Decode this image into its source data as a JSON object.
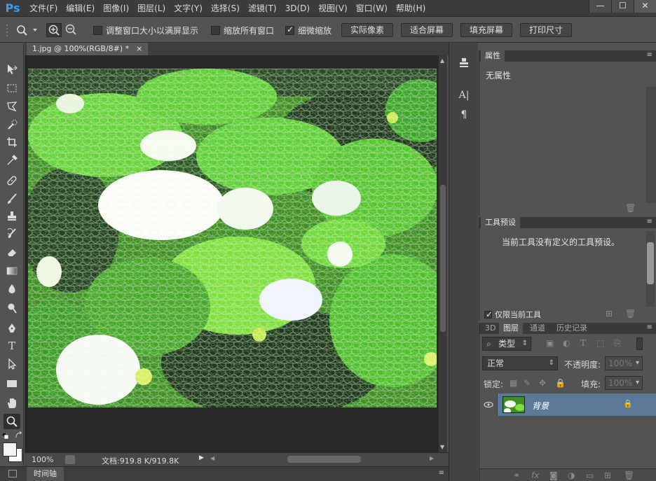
{
  "app": {
    "logo": "Ps"
  },
  "menu": [
    "文件(F)",
    "编辑(E)",
    "图像(I)",
    "图层(L)",
    "文字(Y)",
    "选择(S)",
    "滤镜(T)",
    "3D(D)",
    "视图(V)",
    "窗口(W)",
    "帮助(H)"
  ],
  "window_controls": {
    "minimize": "—",
    "maximize": "☐",
    "close": "✕"
  },
  "options": {
    "resize_windows": {
      "label": "调整窗口大小以满屏显示",
      "checked": false
    },
    "zoom_all": {
      "label": "缩放所有窗口",
      "checked": false
    },
    "scrubby_zoom": {
      "label": "细微缩放",
      "checked": true
    },
    "buttons": [
      "实际像素",
      "适合屏幕",
      "填充屏幕",
      "打印尺寸"
    ]
  },
  "document": {
    "tab_title": "1.jpg @ 100%(RGB/8#) *",
    "tab_close": "×",
    "zoom": "100%",
    "info": "文档:919.8 K/919.8K"
  },
  "timeline": {
    "label": "时间轴"
  },
  "properties": {
    "title": "属性",
    "content": "无属性"
  },
  "tool_presets": {
    "title": "工具预设",
    "message": "当前工具没有定义的工具预设。",
    "current_only": "仅限当前工具",
    "current_only_checked": true
  },
  "layers": {
    "tabs": [
      "3D",
      "图层",
      "通道",
      "历史记录"
    ],
    "active_tab": "图层",
    "filter_label": "类型",
    "blend_mode": "正常",
    "opacity_label": "不透明度:",
    "opacity_value": "100%",
    "lock_label": "锁定:",
    "fill_label": "填充:",
    "fill_value": "100%",
    "items": [
      {
        "name": "背景",
        "visible": true,
        "locked": true
      }
    ]
  },
  "colors": {
    "menubar": "#3c3c3c",
    "panel": "#535353",
    "canvas_bg": "#282828",
    "selected_layer": "#5b7a9a",
    "ps_blue": "#3d9df0"
  }
}
